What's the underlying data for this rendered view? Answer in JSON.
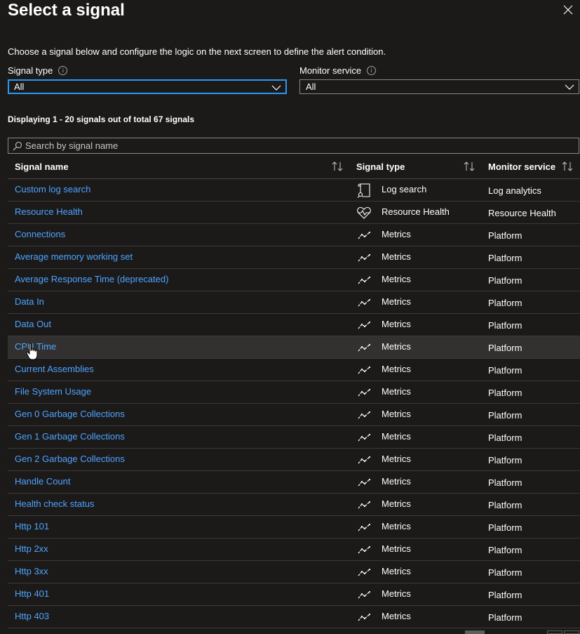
{
  "panel": {
    "title": "Select a signal",
    "description": "Choose a signal below and configure the logic on the next screen to define the alert condition."
  },
  "filters": {
    "signal_type_label": "Signal type",
    "signal_type_value": "All",
    "monitor_service_label": "Monitor service",
    "monitor_service_value": "All"
  },
  "results": {
    "count_text": "Displaying 1 - 20 signals out of total 67 signals"
  },
  "search": {
    "placeholder": "Search by signal name",
    "value": ""
  },
  "table": {
    "headers": {
      "name": "Signal name",
      "type": "Signal type",
      "service": "Monitor service"
    },
    "rows": [
      {
        "name": "Custom log search",
        "type": "Log search",
        "service": "Log analytics",
        "icon": "log-search-icon"
      },
      {
        "name": "Resource Health",
        "type": "Resource Health",
        "service": "Resource Health",
        "icon": "heart-pulse-icon"
      },
      {
        "name": "Connections",
        "type": "Metrics",
        "service": "Platform",
        "icon": "metrics-icon"
      },
      {
        "name": "Average memory working set",
        "type": "Metrics",
        "service": "Platform",
        "icon": "metrics-icon"
      },
      {
        "name": "Average Response Time (deprecated)",
        "type": "Metrics",
        "service": "Platform",
        "icon": "metrics-icon"
      },
      {
        "name": "Data In",
        "type": "Metrics",
        "service": "Platform",
        "icon": "metrics-icon"
      },
      {
        "name": "Data Out",
        "type": "Metrics",
        "service": "Platform",
        "icon": "metrics-icon"
      },
      {
        "name": "CPU Time",
        "type": "Metrics",
        "service": "Platform",
        "icon": "metrics-icon"
      },
      {
        "name": "Current Assemblies",
        "type": "Metrics",
        "service": "Platform",
        "icon": "metrics-icon"
      },
      {
        "name": "File System Usage",
        "type": "Metrics",
        "service": "Platform",
        "icon": "metrics-icon"
      },
      {
        "name": "Gen 0 Garbage Collections",
        "type": "Metrics",
        "service": "Platform",
        "icon": "metrics-icon"
      },
      {
        "name": "Gen 1 Garbage Collections",
        "type": "Metrics",
        "service": "Platform",
        "icon": "metrics-icon"
      },
      {
        "name": "Gen 2 Garbage Collections",
        "type": "Metrics",
        "service": "Platform",
        "icon": "metrics-icon"
      },
      {
        "name": "Handle Count",
        "type": "Metrics",
        "service": "Platform",
        "icon": "metrics-icon"
      },
      {
        "name": "Health check status",
        "type": "Metrics",
        "service": "Platform",
        "icon": "metrics-icon"
      },
      {
        "name": "Http 101",
        "type": "Metrics",
        "service": "Platform",
        "icon": "metrics-icon"
      },
      {
        "name": "Http 2xx",
        "type": "Metrics",
        "service": "Platform",
        "icon": "metrics-icon"
      },
      {
        "name": "Http 3xx",
        "type": "Metrics",
        "service": "Platform",
        "icon": "metrics-icon"
      },
      {
        "name": "Http 401",
        "type": "Metrics",
        "service": "Platform",
        "icon": "metrics-icon"
      },
      {
        "name": "Http 403",
        "type": "Metrics",
        "service": "Platform",
        "icon": "metrics-icon"
      }
    ]
  },
  "colors": {
    "background": "#1b1a19",
    "link": "#4fa3ff",
    "focus_border": "#2899f5",
    "hover_row": "#323130"
  }
}
